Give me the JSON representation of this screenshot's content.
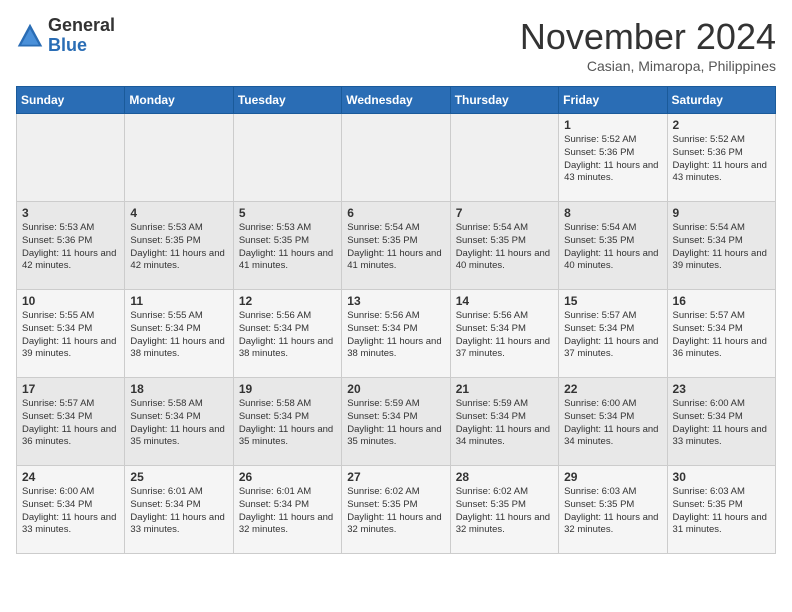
{
  "header": {
    "logo_general": "General",
    "logo_blue": "Blue",
    "title": "November 2024",
    "location": "Casian, Mimaropa, Philippines"
  },
  "calendar": {
    "weekdays": [
      "Sunday",
      "Monday",
      "Tuesday",
      "Wednesday",
      "Thursday",
      "Friday",
      "Saturday"
    ],
    "weeks": [
      [
        {
          "day": "",
          "empty": true
        },
        {
          "day": "",
          "empty": true
        },
        {
          "day": "",
          "empty": true
        },
        {
          "day": "",
          "empty": true
        },
        {
          "day": "",
          "empty": true
        },
        {
          "day": "1",
          "sunrise": "5:52 AM",
          "sunset": "5:36 PM",
          "daylight": "11 hours and 43 minutes."
        },
        {
          "day": "2",
          "sunrise": "5:52 AM",
          "sunset": "5:36 PM",
          "daylight": "11 hours and 43 minutes."
        }
      ],
      [
        {
          "day": "3",
          "sunrise": "5:53 AM",
          "sunset": "5:36 PM",
          "daylight": "11 hours and 42 minutes."
        },
        {
          "day": "4",
          "sunrise": "5:53 AM",
          "sunset": "5:35 PM",
          "daylight": "11 hours and 42 minutes."
        },
        {
          "day": "5",
          "sunrise": "5:53 AM",
          "sunset": "5:35 PM",
          "daylight": "11 hours and 41 minutes."
        },
        {
          "day": "6",
          "sunrise": "5:54 AM",
          "sunset": "5:35 PM",
          "daylight": "11 hours and 41 minutes."
        },
        {
          "day": "7",
          "sunrise": "5:54 AM",
          "sunset": "5:35 PM",
          "daylight": "11 hours and 40 minutes."
        },
        {
          "day": "8",
          "sunrise": "5:54 AM",
          "sunset": "5:35 PM",
          "daylight": "11 hours and 40 minutes."
        },
        {
          "day": "9",
          "sunrise": "5:54 AM",
          "sunset": "5:34 PM",
          "daylight": "11 hours and 39 minutes."
        }
      ],
      [
        {
          "day": "10",
          "sunrise": "5:55 AM",
          "sunset": "5:34 PM",
          "daylight": "11 hours and 39 minutes."
        },
        {
          "day": "11",
          "sunrise": "5:55 AM",
          "sunset": "5:34 PM",
          "daylight": "11 hours and 38 minutes."
        },
        {
          "day": "12",
          "sunrise": "5:56 AM",
          "sunset": "5:34 PM",
          "daylight": "11 hours and 38 minutes."
        },
        {
          "day": "13",
          "sunrise": "5:56 AM",
          "sunset": "5:34 PM",
          "daylight": "11 hours and 38 minutes."
        },
        {
          "day": "14",
          "sunrise": "5:56 AM",
          "sunset": "5:34 PM",
          "daylight": "11 hours and 37 minutes."
        },
        {
          "day": "15",
          "sunrise": "5:57 AM",
          "sunset": "5:34 PM",
          "daylight": "11 hours and 37 minutes."
        },
        {
          "day": "16",
          "sunrise": "5:57 AM",
          "sunset": "5:34 PM",
          "daylight": "11 hours and 36 minutes."
        }
      ],
      [
        {
          "day": "17",
          "sunrise": "5:57 AM",
          "sunset": "5:34 PM",
          "daylight": "11 hours and 36 minutes."
        },
        {
          "day": "18",
          "sunrise": "5:58 AM",
          "sunset": "5:34 PM",
          "daylight": "11 hours and 35 minutes."
        },
        {
          "day": "19",
          "sunrise": "5:58 AM",
          "sunset": "5:34 PM",
          "daylight": "11 hours and 35 minutes."
        },
        {
          "day": "20",
          "sunrise": "5:59 AM",
          "sunset": "5:34 PM",
          "daylight": "11 hours and 35 minutes."
        },
        {
          "day": "21",
          "sunrise": "5:59 AM",
          "sunset": "5:34 PM",
          "daylight": "11 hours and 34 minutes."
        },
        {
          "day": "22",
          "sunrise": "6:00 AM",
          "sunset": "5:34 PM",
          "daylight": "11 hours and 34 minutes."
        },
        {
          "day": "23",
          "sunrise": "6:00 AM",
          "sunset": "5:34 PM",
          "daylight": "11 hours and 33 minutes."
        }
      ],
      [
        {
          "day": "24",
          "sunrise": "6:00 AM",
          "sunset": "5:34 PM",
          "daylight": "11 hours and 33 minutes."
        },
        {
          "day": "25",
          "sunrise": "6:01 AM",
          "sunset": "5:34 PM",
          "daylight": "11 hours and 33 minutes."
        },
        {
          "day": "26",
          "sunrise": "6:01 AM",
          "sunset": "5:34 PM",
          "daylight": "11 hours and 32 minutes."
        },
        {
          "day": "27",
          "sunrise": "6:02 AM",
          "sunset": "5:35 PM",
          "daylight": "11 hours and 32 minutes."
        },
        {
          "day": "28",
          "sunrise": "6:02 AM",
          "sunset": "5:35 PM",
          "daylight": "11 hours and 32 minutes."
        },
        {
          "day": "29",
          "sunrise": "6:03 AM",
          "sunset": "5:35 PM",
          "daylight": "11 hours and 32 minutes."
        },
        {
          "day": "30",
          "sunrise": "6:03 AM",
          "sunset": "5:35 PM",
          "daylight": "11 hours and 31 minutes."
        }
      ]
    ]
  }
}
